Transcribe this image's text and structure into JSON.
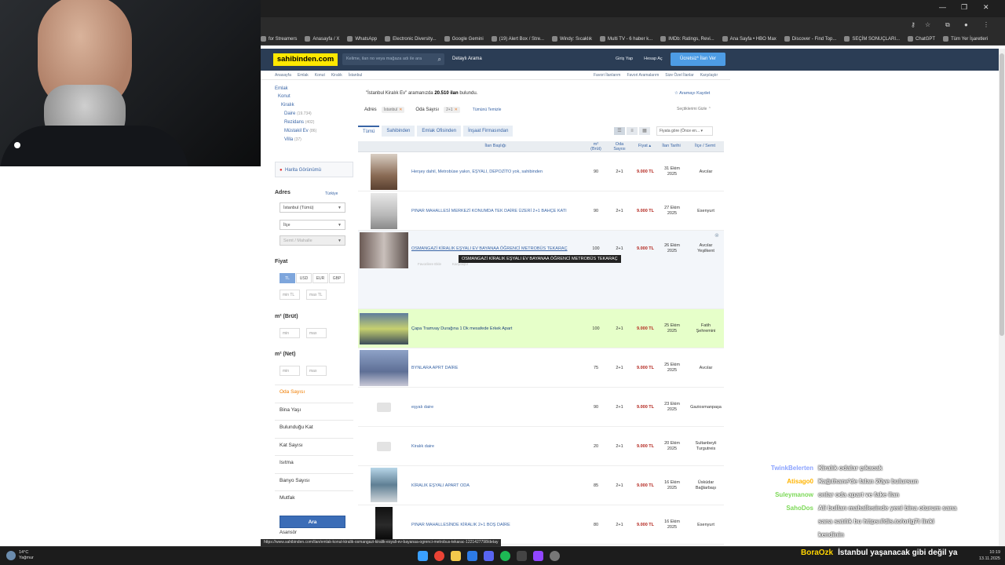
{
  "browser": {
    "bookmarks": [
      {
        "label": "for Streamers"
      },
      {
        "label": "Anasayfa / X"
      },
      {
        "label": "WhatsApp"
      },
      {
        "label": "Electronic Diversity..."
      },
      {
        "label": "Google Gemini"
      },
      {
        "label": "(19) Alert Box / Stre..."
      },
      {
        "label": "Windy: Sıcaklık"
      },
      {
        "label": "Multi TV - 6 haber k..."
      },
      {
        "label": "IMDb: Ratings, Revi..."
      },
      {
        "label": "Ana Sayfa • HBO Max"
      },
      {
        "label": "Discover - Find Top..."
      },
      {
        "label": "SEÇİM SONUÇLARI..."
      },
      {
        "label": "ChatGPT"
      },
      {
        "label": "Tüm Yer İşaretleri"
      }
    ],
    "status_url": "https://www.sahibinden.com/ilan/emlak-konut-kiralik-osmangazi-kiralik-esyali-ev-bayanaa-ogrenci-metrobus-tekarac-1221427798/detay"
  },
  "header": {
    "logo": "sahibinden.com",
    "search_placeholder": "Kelime, ilan no veya mağaza adı ile ara",
    "detailed_search": "Detaylı Arama",
    "login": "Giriş Yap",
    "register": "Hesap Aç",
    "post_ad": "Ücretsiz* İlan Ver"
  },
  "breadcrumbs": [
    "Anasayfa",
    "Emlak",
    "Konut",
    "Kiralık",
    "İstanbul"
  ],
  "top_links": [
    "Favori İlanlarım",
    "Favori Aramalarım",
    "Size Özel İlanlar",
    "Karşılaştır"
  ],
  "sidebar": {
    "categories": [
      {
        "label": "Emlak",
        "count": ""
      },
      {
        "label": "Konut",
        "count": ""
      },
      {
        "label": "Kiralık",
        "count": ""
      },
      {
        "label": "Daire",
        "count": "(19.734)"
      },
      {
        "label": "Rezidans",
        "count": "(402)"
      },
      {
        "label": "Müstakil Ev",
        "count": "(86)"
      },
      {
        "label": "Villa",
        "count": "(37)"
      }
    ],
    "map_button": "Harita Görünümü",
    "address_title": "Adres",
    "address_country": "Türkiye",
    "city_select": "İstanbul (Tümü)",
    "district_select": "İlçe",
    "neighborhood_select": "Semt / Mahalle",
    "price_title": "Fiyat",
    "currencies": [
      "TL",
      "USD",
      "EUR",
      "GBP"
    ],
    "price_min": "min TL",
    "price_max": "max TL",
    "m2_gross_title": "m² (Brüt)",
    "m2_net_title": "m² (Net)",
    "min": "min",
    "max": "max",
    "filters": [
      "Oda Sayısı",
      "Bina Yaşı",
      "Bulunduğu Kat",
      "Kat Sayısı",
      "Isıtma",
      "Banyo Sayısı",
      "Mutfak"
    ],
    "partial_filter": "Asansör",
    "search_button": "Ara"
  },
  "main": {
    "query": "\"İstanbul Kiralık Ev\"",
    "summary_mid": " aramanızda ",
    "count": "20.510 ilan",
    "summary_end": " bulundu.",
    "save_search": "Aramayı Kaydet",
    "filter_addr_label": "Adres",
    "filter_addr_value": "İstanbul",
    "filter_rooms_label": "Oda Sayısı",
    "filter_rooms_value": "2+1",
    "clear_all": "Tümünü Temizle",
    "hide_selected": "Seçtiklerimi Gizle",
    "tabs": [
      "Tümü",
      "Sahibinden",
      "Emlak Ofisinden",
      "İnşaat Firmasından"
    ],
    "sort": "Fiyata göre (Önce en...",
    "columns": {
      "title": "İlan Başlığı",
      "m2": "m²\n(Brüt)",
      "rooms": "Oda\nSayısı",
      "price": "Fiyat",
      "date": "İlan Tarihi",
      "district": "İlçe / Semt"
    },
    "tooltip": "OSMANGAZİ KİRALIK EŞYALI EV BAYANAA ÖĞRENCİ METROBÜS TEKARAÇ",
    "hover_actions": [
      "Favorilere Ekle",
      "Karşılaştır"
    ],
    "listings": [
      {
        "title": "Herşey dahil, Metrobüse yakın, EŞYALI, DEPOZİTO yok, sahibinden",
        "m2": "90",
        "rooms": "2+1",
        "price": "9.000 TL",
        "date1": "31 Ekim",
        "date2": "2025",
        "loc1": "Avcılar",
        "loc2": "",
        "img": "a"
      },
      {
        "title": "PINAR MAHALLESİ MERKEZİ KONUMDA TEK DAİRE ÜZERİ 2+1 BAHÇE KATI",
        "m2": "90",
        "rooms": "2+1",
        "price": "9.000 TL",
        "date1": "27 Ekim",
        "date2": "2025",
        "loc1": "Esenyurt",
        "loc2": "",
        "img": "b"
      },
      {
        "title": "OSMANGAZİ KİRALIK EŞYALI EV BAYANAA ÖĞRENCİ METROBÜS TEKARAÇ",
        "m2": "100",
        "rooms": "2+1",
        "price": "9.000 TL",
        "date1": "26 Ekim",
        "date2": "2025",
        "loc1": "Avcılar",
        "loc2": "Yeşilkent",
        "img": "c"
      },
      {
        "title": "Çapa Tramvay Durağına 1 Dk mesafede Erkek Apart",
        "m2": "100",
        "rooms": "2+1",
        "price": "9.000 TL",
        "date1": "25 Ekim",
        "date2": "2025",
        "loc1": "Fatih",
        "loc2": "Şehremini",
        "img": "d"
      },
      {
        "title": "BYNLARA APRT DAİRE",
        "m2": "75",
        "rooms": "2+1",
        "price": "9.000 TL",
        "date1": "25 Ekim",
        "date2": "2025",
        "loc1": "Avcılar",
        "loc2": "",
        "img": "e"
      },
      {
        "title": "eşyalı daire",
        "m2": "90",
        "rooms": "2+1",
        "price": "9.000 TL",
        "date1": "23 Ekim",
        "date2": "2025",
        "loc1": "Gaziosmanpaşa",
        "loc2": "",
        "img": ""
      },
      {
        "title": "Kiralık daire",
        "m2": "20",
        "rooms": "2+1",
        "price": "9.000 TL",
        "date1": "20 Ekim",
        "date2": "2025",
        "loc1": "Sultanbeyli",
        "loc2": "Turgutreis",
        "img": ""
      },
      {
        "title": "KİRALIK EŞYALI APART ODA",
        "m2": "85",
        "rooms": "2+1",
        "price": "9.000 TL",
        "date1": "16 Ekim",
        "date2": "2025",
        "loc1": "Üsküdar",
        "loc2": "Bağlarbaşı",
        "img": "f"
      },
      {
        "title": "PINAR MAHALLESİNDE KİRALIK 2+1 BOŞ DAİRE",
        "m2": "80",
        "rooms": "2+1",
        "price": "9.000 TL",
        "date1": "16 Ekim",
        "date2": "2025",
        "loc1": "Esenyurt",
        "loc2": "",
        "img": "g"
      }
    ]
  },
  "chat": [
    {
      "user": "TwinkBelerten",
      "color": "#8aa2ff",
      "text": "Kiralık odalar çıkacak"
    },
    {
      "user": "Atisago0",
      "color": "#ffb400",
      "text": "Kağıthane'de falan 20ye bulursun"
    },
    {
      "user": "Suleymanow",
      "color": "#7cd957",
      "text": "onlar oda apart ve fake ilan"
    },
    {
      "user": "SahoDos",
      "color": "#7cd957",
      "text": "Ali bulları mahallesinde yeni bina oturum sana"
    },
    {
      "user": "",
      "color": "#7cd957",
      "text": "sana satılık bu https://dis.to/orlg7t linki"
    },
    {
      "user": "",
      "color": "#7cd957",
      "text": "kendinin"
    }
  ],
  "overlay": {
    "user": "BoraOzk",
    "text": "İstanbul yaşanacak gibi değil ya"
  },
  "taskbar": {
    "temp": "14°C",
    "weather": "Yağmur",
    "time": "10:19",
    "date": "13.11.2025"
  }
}
